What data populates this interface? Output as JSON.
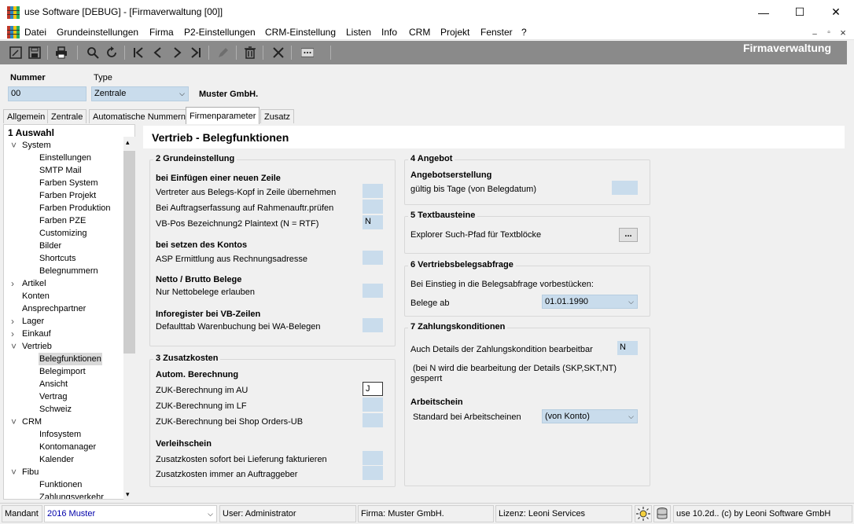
{
  "window": {
    "title": "use Software [DEBUG] - [Firmaverwaltung [00]]",
    "minimize": "—",
    "maximize": "☐",
    "close": "✕"
  },
  "menu": {
    "items": [
      "Datei",
      "Grundeinstellungen",
      "Firma",
      "P2-Einstellungen",
      "CRM-Einstellung",
      "Listen",
      "Info",
      "CRM",
      "Projekt",
      "Fenster",
      "?"
    ],
    "mdi_min": "–",
    "mdi_restore": "▫",
    "mdi_close": "×"
  },
  "toolbar": {
    "title": "Firmaverwaltung"
  },
  "header": {
    "nummer_label": "Nummer",
    "nummer_value": "00",
    "type_label": "Type",
    "type_value": "Zentrale",
    "company_name": "Muster GmbH."
  },
  "tabs": [
    {
      "label": "Allgemein"
    },
    {
      "label": "Zentrale"
    },
    {
      "label": "Automatische Nummern"
    },
    {
      "label": "Firmenparameter"
    },
    {
      "label": "Zusatz"
    }
  ],
  "tree": {
    "rows": [
      {
        "label": "1 Auswahl",
        "level": 0,
        "bold": true,
        "exp": ""
      },
      {
        "label": "System",
        "level": 1,
        "exp": "v"
      },
      {
        "label": "Einstellungen",
        "level": 2,
        "exp": ""
      },
      {
        "label": "SMTP Mail",
        "level": 2,
        "exp": ""
      },
      {
        "label": "Farben System",
        "level": 2,
        "exp": ""
      },
      {
        "label": "Farben Projekt",
        "level": 2,
        "exp": ""
      },
      {
        "label": "Farben Produktion",
        "level": 2,
        "exp": ""
      },
      {
        "label": "Farben PZE",
        "level": 2,
        "exp": ""
      },
      {
        "label": "Customizing",
        "level": 2,
        "exp": ""
      },
      {
        "label": "Bilder",
        "level": 2,
        "exp": ""
      },
      {
        "label": "Shortcuts",
        "level": 2,
        "exp": ""
      },
      {
        "label": "Belegnummern",
        "level": 2,
        "exp": ""
      },
      {
        "label": "Artikel",
        "level": 1,
        "exp": ">"
      },
      {
        "label": "Konten",
        "level": 1,
        "exp": ""
      },
      {
        "label": "Ansprechpartner",
        "level": 1,
        "exp": ""
      },
      {
        "label": "Lager",
        "level": 1,
        "exp": ">"
      },
      {
        "label": "Einkauf",
        "level": 1,
        "exp": ">"
      },
      {
        "label": "Vertrieb",
        "level": 1,
        "exp": "v"
      },
      {
        "label": "Belegfunktionen",
        "level": 2,
        "exp": "",
        "selected": true
      },
      {
        "label": "Belegimport",
        "level": 2,
        "exp": ""
      },
      {
        "label": "Ansicht",
        "level": 2,
        "exp": ""
      },
      {
        "label": "Vertrag",
        "level": 2,
        "exp": ""
      },
      {
        "label": "Schweiz",
        "level": 2,
        "exp": ""
      },
      {
        "label": "CRM",
        "level": 1,
        "exp": "v"
      },
      {
        "label": "Infosystem",
        "level": 2,
        "exp": ""
      },
      {
        "label": "Kontomanager",
        "level": 2,
        "exp": ""
      },
      {
        "label": "Kalender",
        "level": 2,
        "exp": ""
      },
      {
        "label": "Fibu",
        "level": 1,
        "exp": "v"
      },
      {
        "label": "Funktionen",
        "level": 2,
        "exp": ""
      },
      {
        "label": "Zahlungsverkehr",
        "level": 2,
        "exp": ""
      }
    ],
    "scroll_up": "▴",
    "scroll_down": "▾"
  },
  "content": {
    "title": "Vertrieb - Belegfunktionen",
    "g2": {
      "title": "2 Grundeinstellung",
      "s1": "bei Einfügen einer neuen Zeile",
      "r1": "Vertreter aus Belegs-Kopf in Zeile übernehmen",
      "r2": "Bei Auftragserfassung auf Rahmenauftr.prüfen",
      "r3": "VB-Pos Bezeichnung2 Plaintext (N = RTF)",
      "r3_value": "N",
      "s2": "bei setzen des Kontos",
      "r4": "ASP Ermittlung aus Rechnungsadresse",
      "s3": "Netto / Brutto Belege",
      "r5": "Nur Nettobelege erlauben",
      "s4": "Inforegister bei VB-Zeilen",
      "r6": "Defaulttab Warenbuchung bei WA-Belegen"
    },
    "g3": {
      "title": "3 Zusatzkosten",
      "s1": "Autom. Berechnung",
      "r1": "ZUK-Berechnung im AU",
      "r1_value": "J",
      "r2": "ZUK-Berechnung im LF",
      "r3": "ZUK-Berechnung bei Shop Orders-UB",
      "s2": "Verleihschein",
      "r4": "Zusatzkosten sofort bei Lieferung fakturieren",
      "r5": "Zusatzkosten immer an Auftraggeber"
    },
    "g4": {
      "title": "4 Angebot",
      "s1": "Angebotserstellung",
      "r1": "gültig bis Tage (von Belegdatum)"
    },
    "g5": {
      "title": "5 Textbausteine",
      "r1": "Explorer Such-Pfad für Textblöcke",
      "button": "..."
    },
    "g6": {
      "title": "6 Vertriebsbelegsabfrage",
      "r1": "Bei Einstieg in die Belegsabfrage vorbestücken:",
      "r2": "Belege ab",
      "r2_value": "01.01.1990"
    },
    "g7": {
      "title": "7 Zahlungskonditionen",
      "r1": "Auch Details der Zahlungskondition bearbeitbar",
      "r1_value": "N",
      "note1": "(bei N wird die bearbeitung der Details (SKP,SKT,NT)",
      "note2": "gesperrt",
      "s2": "Arbeitschein",
      "r2": "Standard bei Arbeitscheinen",
      "r2_value": "(von Konto)"
    }
  },
  "statusbar": {
    "mandant_label": "Mandant",
    "mandant_value": "2016 Muster",
    "user": "User: Administrator",
    "firma": "Firma: Muster GmbH.",
    "lizenz": "Lizenz: Leoni Services",
    "version": "use 10.2d.. (c) by Leoni Software GmbH"
  }
}
